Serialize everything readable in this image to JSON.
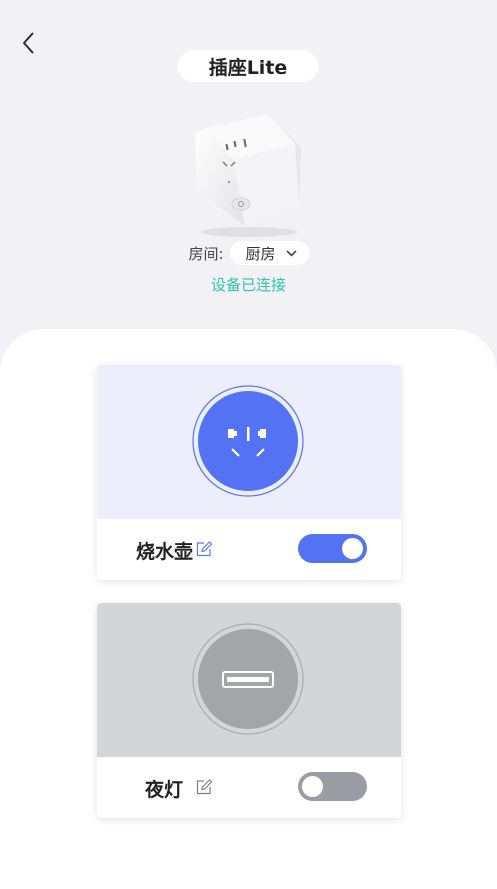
{
  "header": {
    "title": "插座Lite"
  },
  "room": {
    "label": "房间:",
    "value": "厨房"
  },
  "status": "设备已连接",
  "colors": {
    "accent": "#5473f4",
    "status": "#2ec4a8",
    "off": "#9a9ea4"
  },
  "sockets": [
    {
      "name": "烧水壶",
      "type": "ac-outlet",
      "on": true
    },
    {
      "name": "夜灯",
      "type": "usb-port",
      "on": false
    }
  ]
}
